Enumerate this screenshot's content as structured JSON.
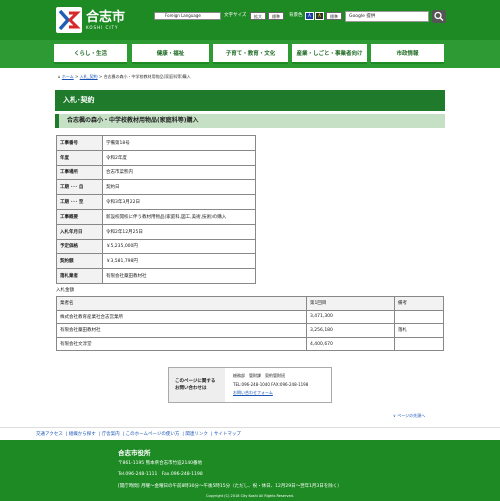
{
  "header": {
    "title": "合志市",
    "subtitle": "KOSHI CITY",
    "foreign_language": "Foreign Language",
    "text_size_label": "文字サイズ",
    "text_size_large": "拡大",
    "text_size_normal": "標準",
    "bg_color_label": "背景色",
    "bg_color_a1": "A",
    "bg_color_a2": "A",
    "bg_color_normal": "標準",
    "search_placeholder": "Google 提供"
  },
  "nav": {
    "items": [
      "くらし・生活",
      "健康・福祉",
      "子育て・教育・文化",
      "産業・しごと・事業者向け",
      "市政情報"
    ]
  },
  "breadcrumb": {
    "items": [
      "ホーム",
      "入札_契約"
    ],
    "current": "合志楓の森小・中学校教材用物品(家庭科等)購入",
    "sep": ">"
  },
  "page": {
    "heading": "入札･契約",
    "subheading": "合志楓の森小・中学校教材用物品(家庭科等)購入"
  },
  "info_table": {
    "rows": [
      {
        "key": "工事番号",
        "value": "学備第18号"
      },
      {
        "key": "年度",
        "value": "令和2年度"
      },
      {
        "key": "工事場所",
        "value": "合志市菜熊内"
      },
      {
        "key": "工期 ･･･ 自",
        "value": "契約日"
      },
      {
        "key": "工期 ･･･ 至",
        "value": "令和3年3月22日"
      },
      {
        "key": "工事概要",
        "value": "新設校開校に伴う教材用物品(家庭科,図工,美術,技術)の購入"
      },
      {
        "key": "入札年月日",
        "value": "令和2年12月25日"
      },
      {
        "key": "予定価格",
        "value": "￥5,235,000円"
      },
      {
        "key": "契約額",
        "value": "￥3,581,798円"
      },
      {
        "key": "落札業者",
        "value": "有限会社藁田教材社"
      }
    ]
  },
  "bids": {
    "caption": "入札金額",
    "headers": [
      "業者名",
      "第1回目",
      "備考"
    ],
    "rows": [
      [
        "株式会社教育産業社合志営業所",
        "3,471,300",
        ""
      ],
      [
        "有限会社藁田教材社",
        "3,256,180",
        "落札"
      ],
      [
        "有限会社文淳堂",
        "4,400,670",
        ""
      ]
    ]
  },
  "contact": {
    "title_line1": "このページに関する",
    "title_line2": "お問い合わせは",
    "dept": "総務部　管財課　契約管財班",
    "tel": "TEL:096-248-1040 FAX:096-248-1198",
    "form_link": "お問い合わせフォーム"
  },
  "page_top": "∨ ページの先頭へ",
  "footer_links": [
    "交通アクセス",
    "組織から探す",
    "庁舎案内",
    "このホームページの使い方",
    "関連リンク",
    "サイトマップ"
  ],
  "footer": {
    "title": "合志市役所",
    "address": "〒861-1195 熊本県合志市竹迫2140番地",
    "phone": "Tel.096-248-1111　Fax.096-248-1198",
    "hours": "[開庁時間] 月曜～金曜日の午前8時30分～午後5時15分（ただし、祝・休日、12月29日～翌年1月3日を除く）",
    "copyright": "Copyright (C) 2018 City Koshi All Rights Reserved."
  },
  "colors": {
    "brand_green": "#1e8a24",
    "heading_green": "#1f7a2b",
    "subheading_bg": "#c5e0c5",
    "link_blue": "#1a55b5"
  }
}
